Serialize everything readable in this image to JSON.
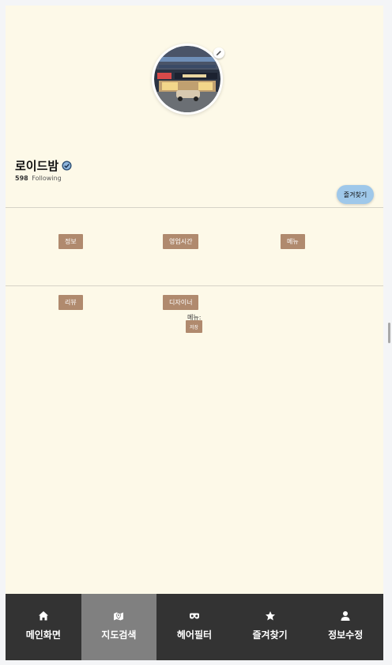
{
  "profile": {
    "name": "로이드밤",
    "following_count": "598",
    "following_label": "Following",
    "favorite_button": "즐겨찾기"
  },
  "tabs_row1": [
    "정보",
    "영업시간",
    "메뉴"
  ],
  "tabs_row2": [
    "리뷰",
    "디자이너"
  ],
  "menu_section": {
    "label": "메뉴:",
    "save_button": "저장"
  },
  "bottom_nav": {
    "items": [
      {
        "label": "메인화면",
        "icon": "home-icon"
      },
      {
        "label": "지도검색",
        "icon": "map-icon",
        "active": true
      },
      {
        "label": "헤어필터",
        "icon": "mask-icon"
      },
      {
        "label": "즐겨찾기",
        "icon": "star-icon"
      },
      {
        "label": "정보수정",
        "icon": "user-icon"
      }
    ]
  },
  "colors": {
    "background": "#fdf9e8",
    "tag": "#b08a6e",
    "favorite_button": "#9fc8ea",
    "nav_bg": "#333333",
    "nav_active": "#808080"
  }
}
